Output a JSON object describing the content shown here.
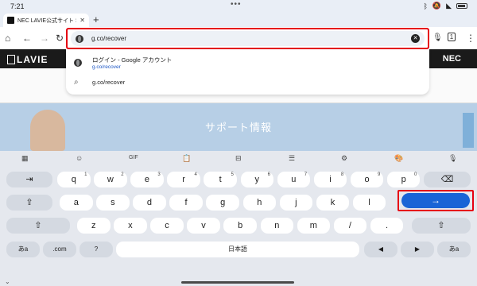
{
  "status": {
    "time": "7:21"
  },
  "tab": {
    "title": "NEC LAVIE公式サイト > サ",
    "close": "✕",
    "new_tab": "+"
  },
  "toolbar": {
    "url": "g.co/recover"
  },
  "suggestions": [
    {
      "title": "ログイン - Google アカウント",
      "subtitle": "g.co/recover"
    },
    {
      "title": "g.co/recover"
    }
  ],
  "webpage": {
    "logo": "LAVIE",
    "brand": "NEC",
    "hero_title": "サポート情報"
  },
  "keyboard": {
    "toolbar_icons": [
      "apps-icon",
      "sticker-icon",
      "gif-icon",
      "clipboard-icon",
      "resize-icon",
      "text-edit-icon",
      "settings-icon",
      "theme-icon",
      "mic-icon"
    ],
    "gif_label": "GIF",
    "row1": [
      {
        "label": "q",
        "hint": "1"
      },
      {
        "label": "w",
        "hint": "2"
      },
      {
        "label": "e",
        "hint": "3"
      },
      {
        "label": "r",
        "hint": "4"
      },
      {
        "label": "t",
        "hint": "5"
      },
      {
        "label": "y",
        "hint": "6"
      },
      {
        "label": "u",
        "hint": "7"
      },
      {
        "label": "i",
        "hint": "8"
      },
      {
        "label": "o",
        "hint": "9"
      },
      {
        "label": "p",
        "hint": "0"
      }
    ],
    "row2": [
      "a",
      "s",
      "d",
      "f",
      "g",
      "h",
      "j",
      "k",
      "l"
    ],
    "row3": [
      "z",
      "x",
      "c",
      "v",
      "b",
      "n",
      "m",
      "/",
      "."
    ],
    "tab_key": "⇥",
    "caps_key": "⇪",
    "backspace_key": "⌫",
    "shift_key": "⇧",
    "enter_key": "→",
    "lang_key": "あa",
    "com_key": ".com",
    "question_key": "?",
    "space_label": "日本語",
    "left_key": "◀",
    "right_key": "▶"
  }
}
